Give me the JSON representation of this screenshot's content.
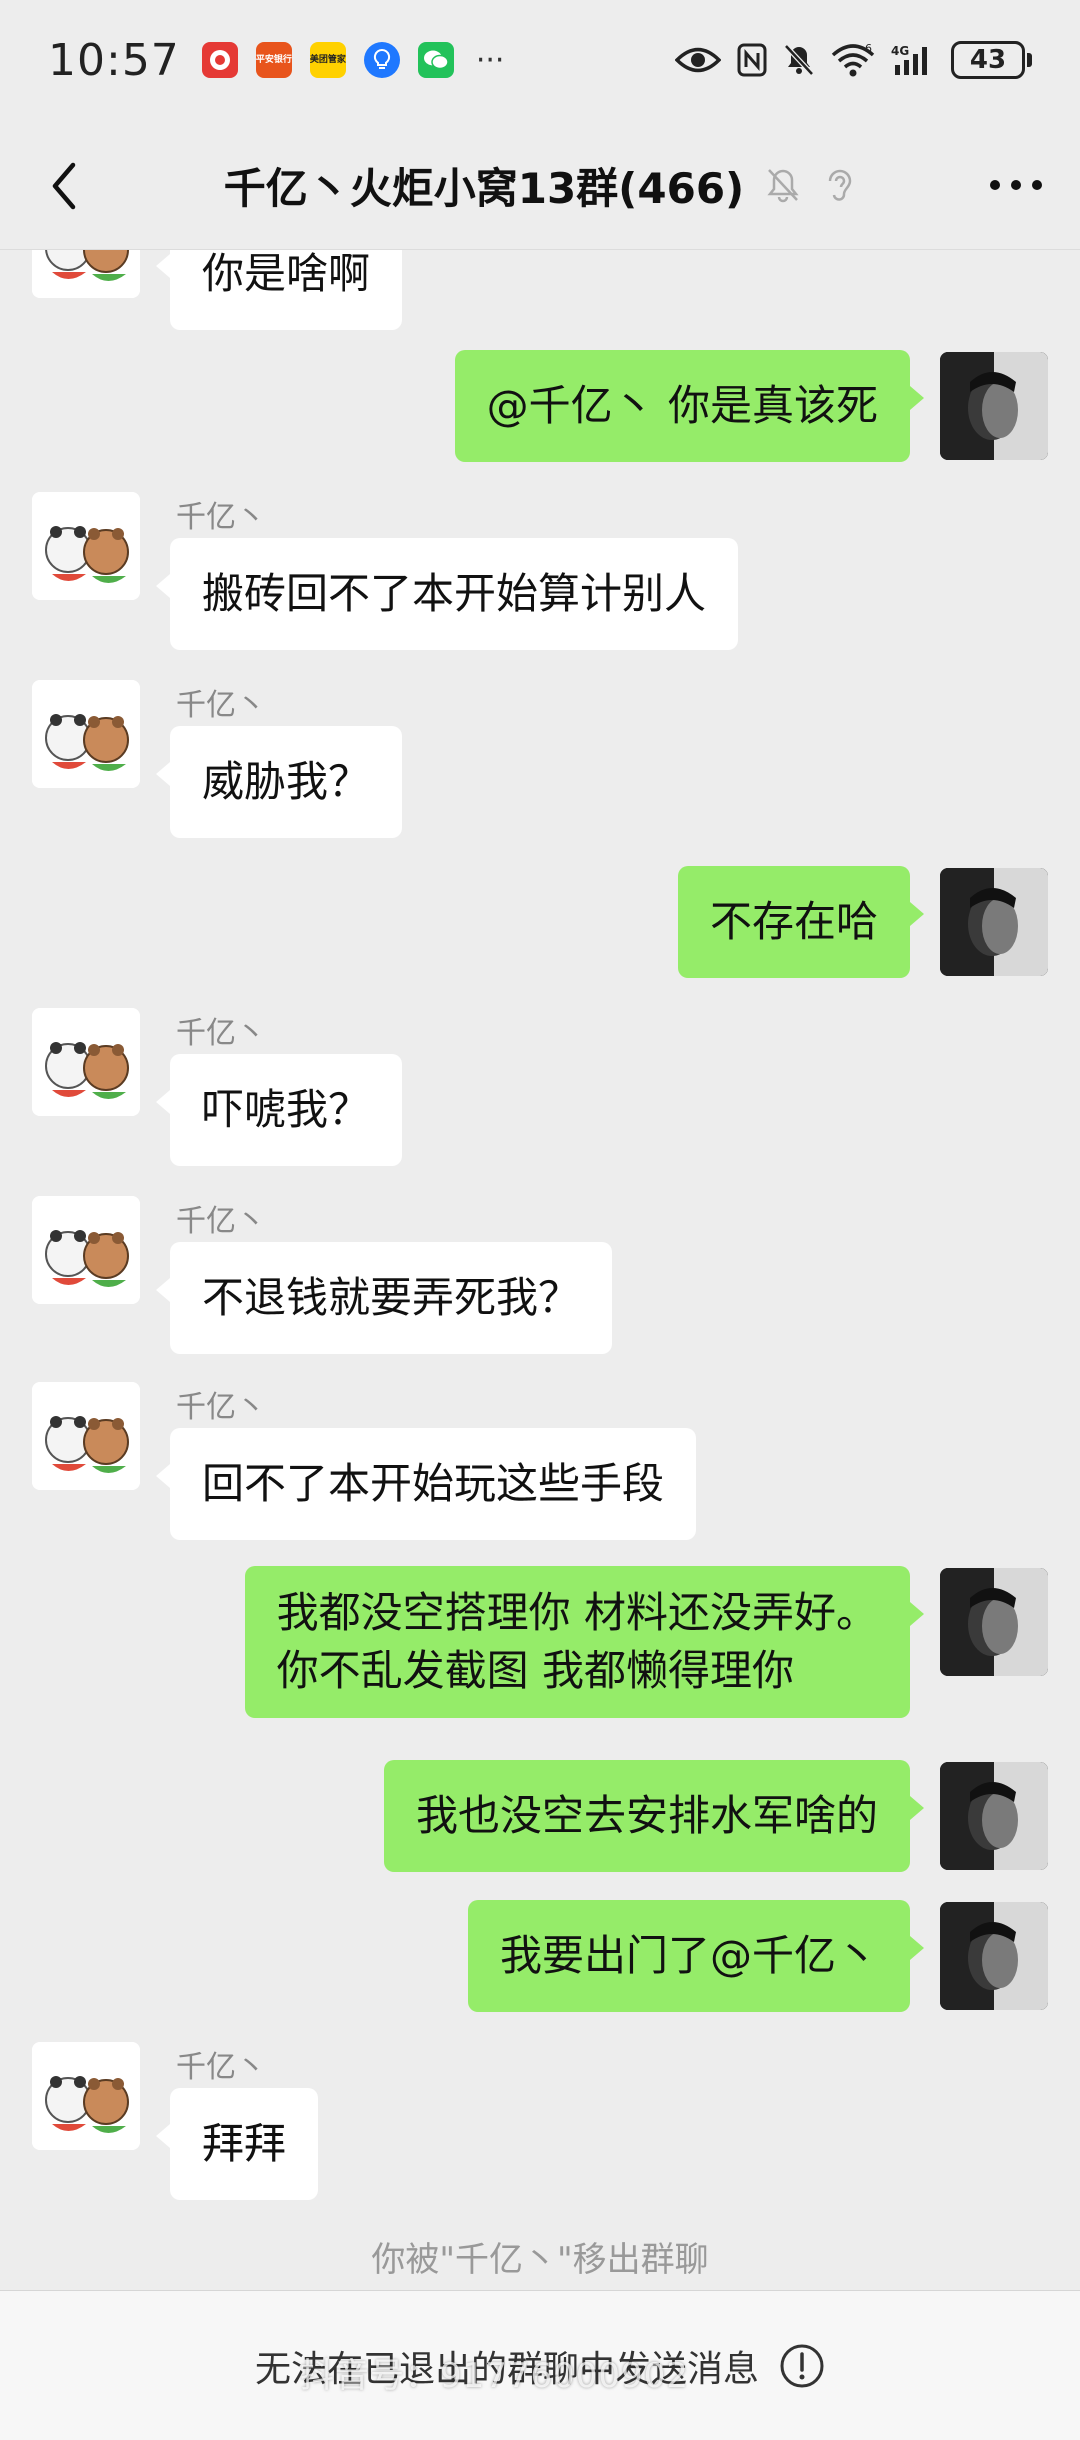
{
  "status_bar": {
    "time": "10:57",
    "app_icons": [
      {
        "name": "pingan-icon",
        "label": ""
      },
      {
        "name": "pingan-bank-icon",
        "label": "平安银行"
      },
      {
        "name": "meituan-icon",
        "label": "美团管家"
      },
      {
        "name": "lightbulb-app-icon",
        "label": ""
      },
      {
        "name": "wechat-icon",
        "label": ""
      }
    ],
    "more": "···",
    "signal_label": "4G",
    "wifi_label": "6",
    "battery": "43"
  },
  "header": {
    "title": "千亿丶火炬小窝13群(466)"
  },
  "messages": [
    {
      "side": "in",
      "sender": "",
      "text": "你是啥啊"
    },
    {
      "side": "out",
      "text": "@千亿丶  你是真该死"
    },
    {
      "side": "in",
      "sender": "千亿丶",
      "text": "搬砖回不了本开始算计别人"
    },
    {
      "side": "in",
      "sender": "千亿丶",
      "text": "威胁我？"
    },
    {
      "side": "out",
      "text": "不存在哈"
    },
    {
      "side": "in",
      "sender": "千亿丶",
      "text": "吓唬我？"
    },
    {
      "side": "in",
      "sender": "千亿丶",
      "text": "不退钱就要弄死我？"
    },
    {
      "side": "in",
      "sender": "千亿丶",
      "text": "回不了本开始玩这些手段"
    },
    {
      "side": "out",
      "text_lines": [
        "我都没空搭理你 材料还没弄好。",
        "你不乱发截图 我都懒得理你"
      ]
    },
    {
      "side": "out",
      "text": "我也没空去安排水军啥的"
    },
    {
      "side": "out",
      "text": "我要出门了@千亿丶"
    },
    {
      "side": "in",
      "sender": "千亿丶",
      "text": "拜拜"
    }
  ],
  "system_message": "你被\"千亿丶\"移出群聊",
  "bottom_bar": {
    "text": "无法在已退出的群聊中发送消息"
  },
  "watermark": "抖音号：91776000902"
}
